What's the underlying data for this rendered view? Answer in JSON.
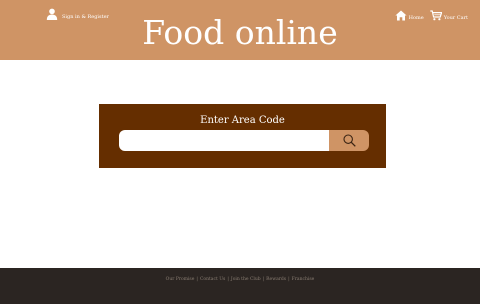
{
  "header": {
    "signin_label": "Sign in & Register",
    "title": "Food online",
    "nav": {
      "home_label": "Home",
      "cart_label": "Your Cart"
    }
  },
  "search": {
    "title": "Enter Area Code",
    "value": "",
    "placeholder": ""
  },
  "footer": {
    "links": [
      "Our Promise",
      "Contact Us",
      "Join the Club",
      "Rewards",
      "Franchise"
    ]
  },
  "colors": {
    "header_bg": "#cf9465",
    "panel_bg": "#652e00",
    "footer_bg": "#2b2522"
  },
  "icons": [
    "user-icon",
    "home-icon",
    "cart-icon",
    "magnifier-icon"
  ]
}
